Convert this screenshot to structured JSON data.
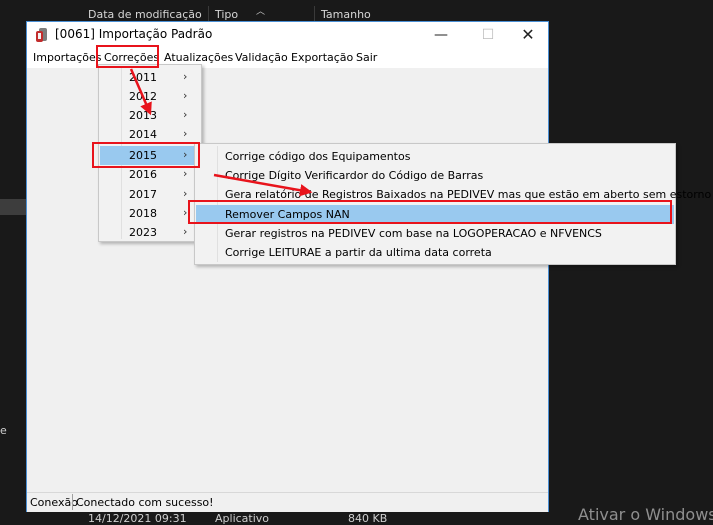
{
  "background": {
    "columns": [
      "Data de modificação",
      "Tipo",
      "Tamanho"
    ],
    "bottom_row": [
      "14/12/2021 09:31",
      "Aplicativo",
      "840 KB"
    ],
    "left_text": "e",
    "watermark": "Ativar o Windows"
  },
  "window": {
    "title": "[0061] Importação Padrão",
    "controls": {
      "minimize": "—",
      "maximize": "☐",
      "close": "✕"
    },
    "menu": [
      "Importações",
      "Correções",
      "Atualizações",
      "Validação",
      "Exportação",
      "Sair"
    ],
    "status": {
      "label": "Conexão",
      "value": "Conectado com sucesso!"
    }
  },
  "years_menu": {
    "items": [
      "2011",
      "2012",
      "2013",
      "2014",
      "2015",
      "2016",
      "2017",
      "2018",
      "2023"
    ],
    "selected": "2015",
    "arrow": "›"
  },
  "options_menu": {
    "items": [
      "Corrige código dos Equipamentos",
      "Corrige Dígito Verificardor do Código de Barras",
      "Gera relatório de Registros Baixados na PEDIVEV mas que estão em aberto sem estorno",
      "Remover Campos NAN",
      "Gerar registros na PEDIVEV com base na LOGOPERACAO e NFVENCS",
      "Corrige LEITURAE a partir da ultima data correta"
    ],
    "selected": "Remover Campos NAN"
  },
  "annotation_color": "#e8131b",
  "highlight_color": "#99c9ef"
}
